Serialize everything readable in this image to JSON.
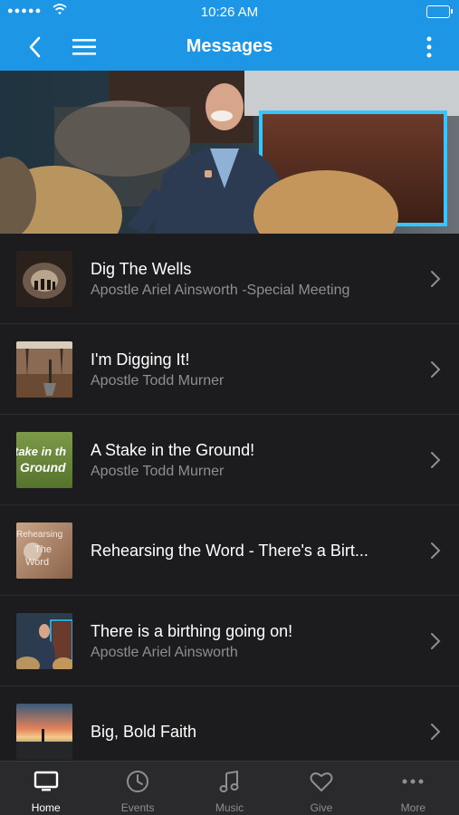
{
  "status_bar": {
    "signal": "●●●●●",
    "time": "10:26 AM"
  },
  "nav": {
    "title": "Messages"
  },
  "messages": [
    {
      "title": "Dig The Wells",
      "subtitle": "Apostle Ariel Ainsworth -Special Meeting"
    },
    {
      "title": "I'm Digging It!",
      "subtitle": "Apostle Todd Murner"
    },
    {
      "title": "A Stake in the Ground!",
      "subtitle": "Apostle Todd Murner",
      "thumb_text_1": "take in th",
      "thumb_text_2": "Ground"
    },
    {
      "title": "Rehearsing the Word -  There's a Birt...",
      "thumb_text_1": "Rehearsing",
      "thumb_text_2": "The",
      "thumb_text_3": "Word"
    },
    {
      "title": "There is a birthing going on!",
      "subtitle": "Apostle Ariel Ainsworth"
    },
    {
      "title": "Big, Bold Faith"
    }
  ],
  "tabs": [
    {
      "label": "Home",
      "icon": "tv-icon",
      "active": true
    },
    {
      "label": "Events",
      "icon": "clock-icon"
    },
    {
      "label": "Music",
      "icon": "music-note-icon"
    },
    {
      "label": "Give",
      "icon": "heart-icon"
    },
    {
      "label": "More",
      "icon": "ellipsis-icon"
    }
  ],
  "colors": {
    "accent": "#1e96e6",
    "background": "#1c1c1e",
    "tabbar": "#2a2a2c"
  }
}
